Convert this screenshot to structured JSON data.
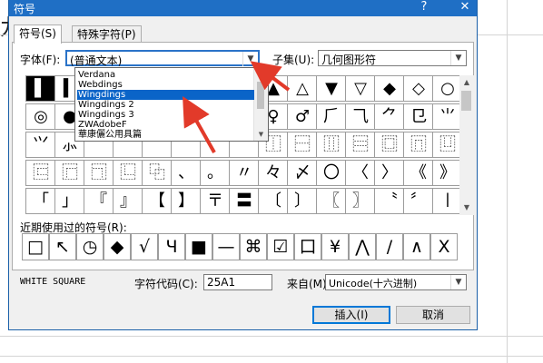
{
  "background": {
    "cell_char": "九"
  },
  "window": {
    "title": "符号",
    "help_label": "?",
    "close_label": "✕"
  },
  "tabs": [
    {
      "label": "符号(S)",
      "active": true
    },
    {
      "label": "特殊字符(P)",
      "active": false
    }
  ],
  "font_field": {
    "label": "字体(F):",
    "value": "(普通文本)"
  },
  "subset_field": {
    "label": "子集(U):",
    "value": "几何图形符"
  },
  "font_dropdown": {
    "options": [
      "Verdana",
      "Webdings",
      "Wingdings",
      "Wingdings 2",
      "Wingdings 3",
      "ZWAdobeF",
      "華康儷公用具篇"
    ],
    "selected": "Wingdings"
  },
  "symbol_grid": [
    [
      "▌",
      "▍",
      "",
      "",
      "",
      "",
      "",
      "",
      "▲",
      "△",
      "▼",
      "▽",
      "◆",
      "◇",
      "○"
    ],
    [
      "◎",
      "●",
      "",
      "",
      "",
      "",
      "",
      "",
      "♀",
      "♂",
      "⺁",
      "⺄",
      "⺈",
      "⺋",
      "⺌"
    ],
    [
      "⺍",
      "⺗",
      "",
      "",
      "",
      "",
      "",
      "",
      "⿰",
      "⿱",
      "⿲",
      "⿳",
      "⿴",
      "⿵",
      "⿶"
    ],
    [
      "⿷",
      "⿸",
      "⿹",
      "⿺",
      "⿻",
      "、",
      "。",
      "〃",
      "々",
      "〆",
      "〇",
      "〈",
      "〉",
      "《",
      "》"
    ],
    [
      "「",
      "」",
      "『",
      "』",
      "【",
      "】",
      "〒",
      "〓",
      "〔",
      "〕",
      "〖",
      "〗",
      "〝",
      "〞",
      "〡"
    ]
  ],
  "selected_symbol": {
    "row": 0,
    "col": 0
  },
  "recent": {
    "label": "近期使用过的符号(R):",
    "symbols": [
      "□",
      "↖",
      "◷",
      "◆",
      "√",
      "Ч",
      "■",
      "—",
      "⌘",
      "☑",
      "口",
      "¥",
      "⋀",
      "/",
      "∧",
      "X"
    ]
  },
  "status": {
    "char_name": "WHITE SQUARE",
    "code_label": "字符代码(C):",
    "code_value": "25A1",
    "from_label": "来自(M):",
    "from_value": "Unicode(十六进制)"
  },
  "buttons": {
    "insert": "插入(I)",
    "cancel": "取消"
  },
  "colors": {
    "titlebar": "#1f6fc5",
    "dropdown_highlight": "#0a64c8",
    "annotation_arrow": "#e23a2a",
    "dialog_bg": "#f0f0f0"
  }
}
